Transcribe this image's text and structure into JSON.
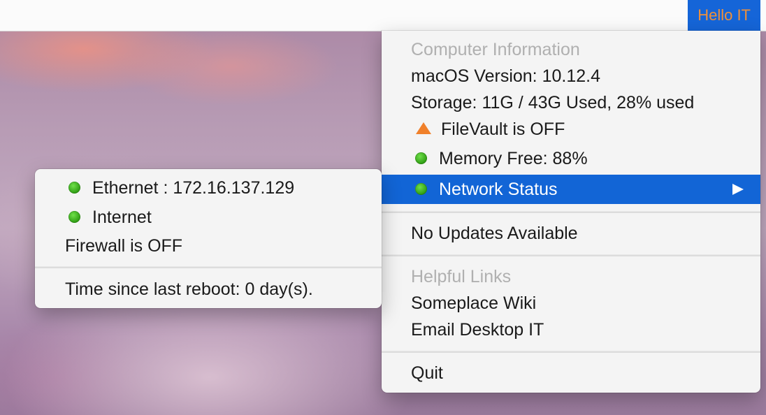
{
  "menubar": {
    "status_item_label": "Hello IT"
  },
  "main_menu": {
    "computer_info_header": "Computer Information",
    "macos_version": "macOS Version: 10.12.4",
    "storage": "Storage: 11G / 43G Used, 28% used",
    "filevault": {
      "label": "FileVault is OFF",
      "icon": "warning-triangle-icon",
      "icon_color": "#f0802a"
    },
    "memory": {
      "label": "Memory Free: 88%",
      "icon": "green-status-dot-icon",
      "icon_color": "#3fb81b"
    },
    "network_status": {
      "label": "Network Status",
      "icon": "green-status-dot-icon",
      "highlighted": true
    },
    "updates": "No Updates Available",
    "helpful_links_header": "Helpful Links",
    "links": [
      "Someplace Wiki",
      "Email Desktop IT"
    ],
    "quit": "Quit"
  },
  "network_submenu": {
    "ethernet": {
      "label": "Ethernet : 172.16.137.129",
      "icon": "green-status-dot-icon"
    },
    "internet": {
      "label": "Internet",
      "icon": "green-status-dot-icon"
    },
    "firewall": "Firewall is OFF",
    "uptime": "Time since last reboot: 0 day(s)."
  },
  "colors": {
    "highlight": "#1265d6",
    "status_item_bg": "#1565d8",
    "status_item_text": "#f0903a"
  }
}
